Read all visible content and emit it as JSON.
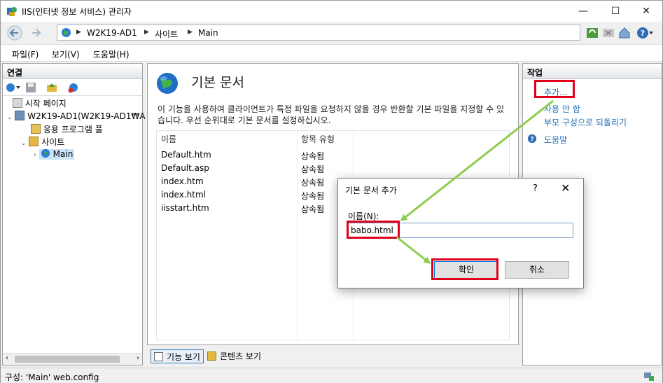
{
  "window": {
    "title": "IIS(인터넷 정보 서비스) 관리자",
    "minimize": "—",
    "maximize": "☐",
    "close": "✕"
  },
  "address": {
    "crumbs": [
      "W2K19-AD1",
      "사이트",
      "Main"
    ]
  },
  "menu": {
    "file": "파일(F)",
    "view": "보기(V)",
    "help": "도움말(H)"
  },
  "connections": {
    "header": "연결",
    "tree": {
      "start_page": "시작 페이지",
      "server": "W2K19-AD1(W2K19-AD1₩A",
      "app_pools": "응용 프로그램 풀",
      "sites": "사이트",
      "main": "Main"
    }
  },
  "feature": {
    "title": "기본 문서",
    "description": "이 기능을 사용하여 클라이언트가 특정 파일을 요청하지 않을 경우 반환할 기본 파일을 지정할 수 있습니다. 우선 순위대로 기본 문서를 설정하십시오.",
    "columns": {
      "name": "이름",
      "entry_type": "항목 유형"
    },
    "rows": [
      {
        "name": "Default.htm",
        "type": "상속됨"
      },
      {
        "name": "Default.asp",
        "type": "상속됨"
      },
      {
        "name": "index.htm",
        "type": "상속됨"
      },
      {
        "name": "index.html",
        "type": "상속됨"
      },
      {
        "name": "iisstart.htm",
        "type": "상속됨"
      }
    ]
  },
  "bottom_tabs": {
    "features_view": "기능 보기",
    "content_view": "콘텐츠 보기"
  },
  "actions": {
    "header": "작업",
    "add": "추가...",
    "disable": "사용 안 함",
    "revert": "부모 구성으로 되돌리기",
    "help": "도움말"
  },
  "status": {
    "text": "구성: 'Main' web.config"
  },
  "dialog": {
    "title": "기본 문서 추가",
    "help": "?",
    "close": "✕",
    "name_label": "이름(N):",
    "name_value": "babo.html",
    "ok": "확인",
    "cancel": "취소"
  },
  "colors": {
    "highlight": "#e0001b",
    "arrow": "#8ccc4e",
    "link": "#1c6fb5"
  }
}
